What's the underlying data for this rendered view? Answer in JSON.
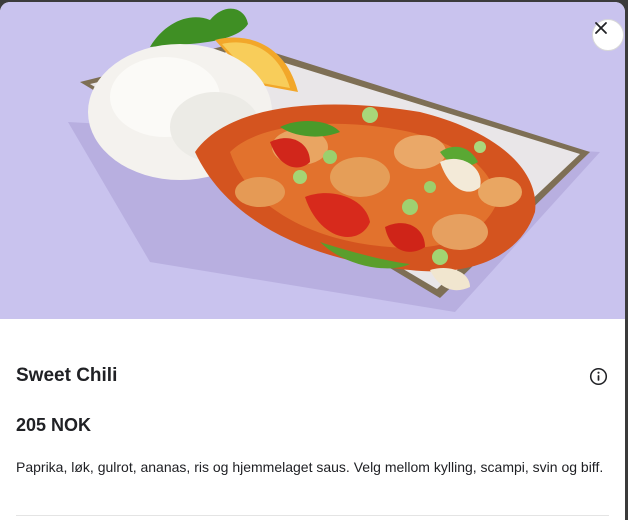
{
  "item": {
    "name": "Sweet Chili",
    "price": "205 NOK",
    "description": "Paprika, løk, gulrot, ananas, ris og hjemmelaget saus. Velg mellom kylling, scampi, svin og biff."
  },
  "icons": {
    "close": "close-icon",
    "info": "info-icon"
  },
  "colors": {
    "hero_background": "#c9c3ee",
    "text": "#202125"
  }
}
